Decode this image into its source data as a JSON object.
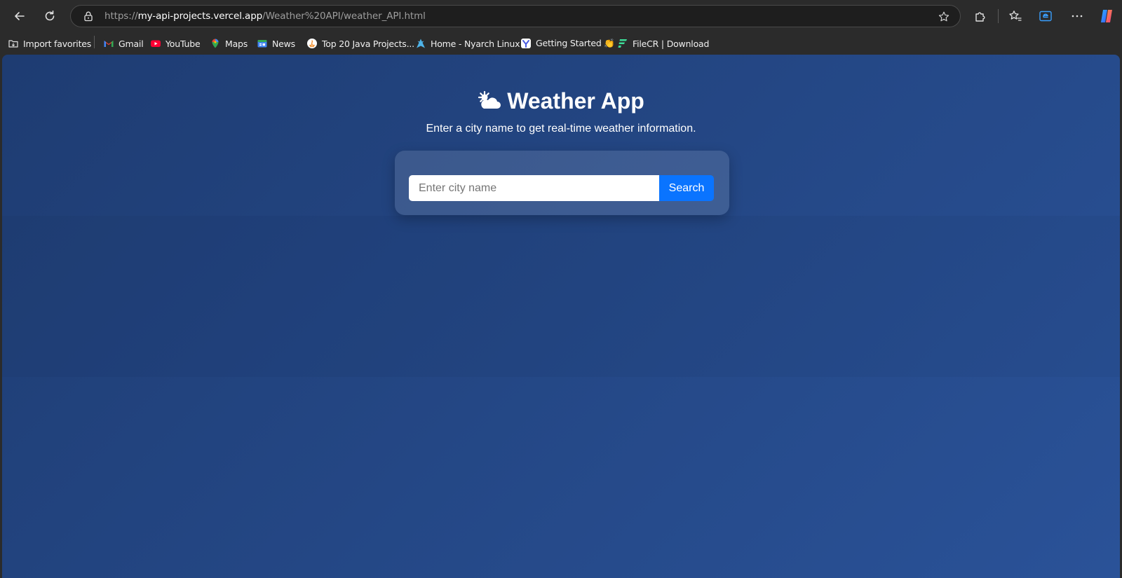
{
  "browser": {
    "url_scheme": "https://",
    "url_host": "my-api-projects.vercel.app",
    "url_path": "/Weather%20API/weather_API.html"
  },
  "bookmarks": [
    {
      "label": "Import favorites",
      "icon": "import-favorites-icon"
    },
    {
      "label": "Gmail",
      "icon": "gmail-icon"
    },
    {
      "label": "YouTube",
      "icon": "youtube-icon"
    },
    {
      "label": "Maps",
      "icon": "maps-pin-icon"
    },
    {
      "label": "News",
      "icon": "news-icon"
    },
    {
      "label": "Top 20 Java Projects...",
      "icon": "java-projects-icon"
    },
    {
      "label": "Home - Nyarch Linux",
      "icon": "nyarch-linux-icon"
    },
    {
      "label": "Getting Started 👏",
      "icon": "getting-started-icon"
    },
    {
      "label": "FileCR | Download",
      "icon": "filecr-icon"
    }
  ],
  "page": {
    "title": "Weather App",
    "title_icon": "sun-behind-cloud-icon",
    "subtitle": "Enter a city name to get real-time weather information.",
    "search_placeholder": "Enter city name",
    "search_button": "Search"
  },
  "colors": {
    "gradient_start": "#1e3c72",
    "gradient_end": "#2a5298",
    "button_blue": "#0a74ff"
  }
}
